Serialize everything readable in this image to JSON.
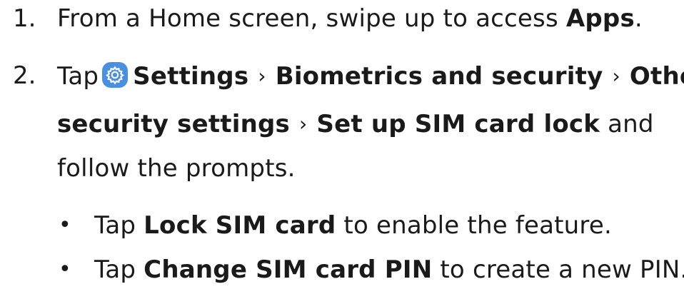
{
  "step1": {
    "number": "1.",
    "text_before": "From a Home screen, swipe up to access ",
    "bold_apps": "Apps",
    "text_after": "."
  },
  "step2": {
    "number": "2.",
    "tap": "Tap",
    "icon": "settings-gear-icon",
    "icon_color": "#4a90e2",
    "settings": "Settings",
    "sep": "›",
    "biometrics": "Biometrics and security",
    "other": "Other",
    "security_settings": "security settings",
    "setup_sim_lock": "Set up SIM card lock",
    "and": " and",
    "follow": "follow the prompts."
  },
  "bullets": [
    {
      "symbol": "•",
      "tap": "Tap ",
      "bold": "Lock SIM card",
      "rest": " to enable the feature."
    },
    {
      "symbol": "•",
      "tap": "Tap ",
      "bold": "Change SIM card PIN",
      "rest": " to create a new PIN."
    }
  ]
}
